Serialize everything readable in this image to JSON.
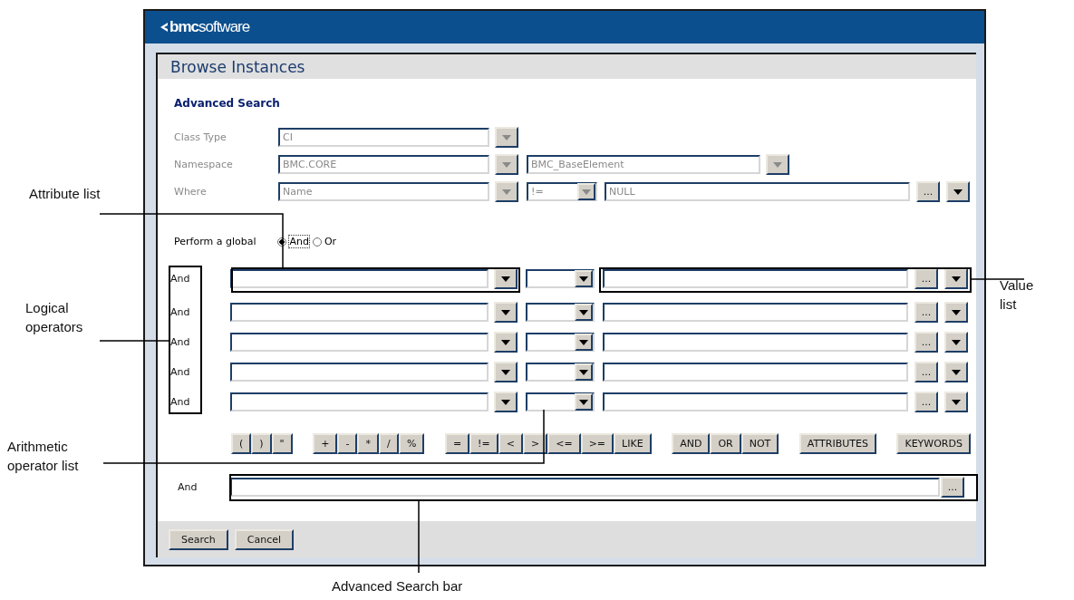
{
  "header": {
    "logo_bold": "bmc",
    "logo_rest": "software"
  },
  "title": "Browse Instances",
  "section": "Advanced Search",
  "class_type": {
    "label": "Class Type",
    "value": "CI",
    "disabled": true
  },
  "namespace": {
    "label": "Namespace",
    "value": "BMC.CORE",
    "class_value": "BMC_BaseElement",
    "disabled": true
  },
  "where": {
    "label": "Where",
    "attribute": "Name",
    "operator": "!=",
    "value": "NULL",
    "browse": "...",
    "disabled": true
  },
  "global": {
    "label": "Perform a global",
    "options": [
      {
        "label": "And",
        "selected": true
      },
      {
        "label": "Or",
        "selected": false
      }
    ]
  },
  "conditions": [
    {
      "logic": "And",
      "browse": "..."
    },
    {
      "logic": "And",
      "browse": "..."
    },
    {
      "logic": "And",
      "browse": "..."
    },
    {
      "logic": "And",
      "browse": "..."
    },
    {
      "logic": "And",
      "browse": "..."
    }
  ],
  "operator_groups": [
    [
      "(",
      ")",
      "\""
    ],
    [
      "+",
      "-",
      "*",
      "/",
      "%"
    ],
    [
      "=",
      "!=",
      "<",
      ">",
      "<=",
      ">=",
      "LIKE"
    ],
    [
      "AND",
      "OR",
      "NOT"
    ],
    [
      "ATTRIBUTES"
    ],
    [
      "KEYWORDS"
    ]
  ],
  "search_bar": {
    "label": "And",
    "browse": "..."
  },
  "buttons": [
    "Search",
    "Cancel"
  ],
  "callouts": [
    {
      "kind": "attribute",
      "text": "Attribute list"
    },
    {
      "kind": "logical",
      "text": "Logical operators"
    },
    {
      "kind": "arithmetic",
      "text": "Arithmetic operator list"
    },
    {
      "kind": "value",
      "text": "Value list"
    },
    {
      "kind": "bar",
      "text": "Advanced Search bar"
    }
  ]
}
